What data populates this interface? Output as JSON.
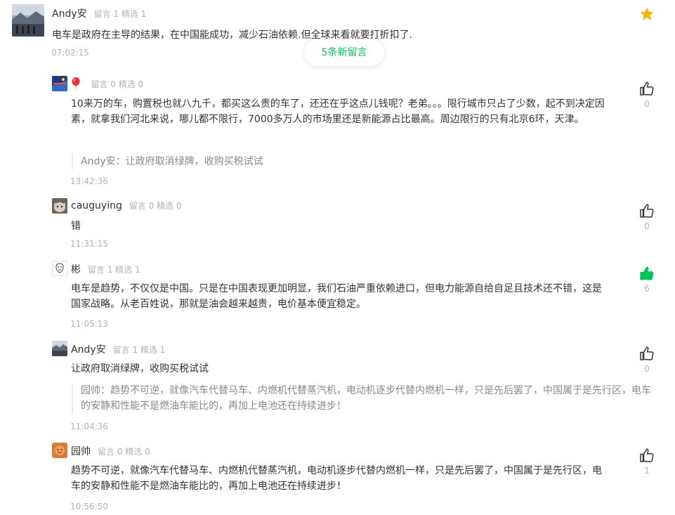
{
  "colors": {
    "accent_green": "#07c160",
    "star_gold": "#f4b400",
    "meta_gray": "#b2b2b2",
    "quote_gray": "#888888"
  },
  "top_comment": {
    "name": "Andy安",
    "meta": "留言 1 精选 1",
    "text": "电车是政府在主导的结果，在中国能成功，减少石油依赖.但全球来看就要打折扣了.",
    "time": "07:02:15",
    "star_icon": "star-icon"
  },
  "new_messages_pill": "5条新留言",
  "replies": [
    {
      "name": "",
      "name_icon": "balloon-icon",
      "meta": "留言 0 精选 0",
      "text": "10来万的车，购置税也就八九千，都买这么贵的车了，还还在乎这点儿钱呢？老弟。。。限行城市只占了少数，起不到决定因素，就拿我们河北来说，哪儿都不限行，7000多万人的市场里还是新能源占比最高。周边限行的只有北京6环，天津。",
      "quote": "Andy安：让政府取消绿牌，收购买税试试",
      "time": "13:42:36",
      "likes": "0",
      "liked": false
    },
    {
      "name": "cauguying",
      "meta": "留言 0 精选 0",
      "text": "错",
      "time": "11:31:15",
      "likes": "0",
      "liked": false
    },
    {
      "name": "彬",
      "meta": "留言 1 精选 1",
      "text": "电车是趋势，不仅仅是中国。只是在中国表现更加明显，我们石油严重依赖进口，但电力能源自给自足且技术还不错，这是国家战略。从老百姓说，那就是油会越来越贵，电价基本便宜稳定。",
      "time": "11:05:13",
      "likes": "6",
      "liked": true
    },
    {
      "name": "Andy安",
      "meta": "留言 1 精选 1",
      "text": "让政府取消绿牌，收购买税试试",
      "quote": "园帅：趋势不可逆，就像汽车代替马车、内燃机代替蒸汽机，电动机逐步代替内燃机一样，只是先后罢了，中国属于是先行区，电车的安静和性能不是燃油车能比的，再加上电池还在持续进步！",
      "time": "11:04:36",
      "likes": "0",
      "liked": false
    },
    {
      "name": "园帅",
      "meta": "留言 0 精选 0",
      "text": "趋势不可逆，就像汽车代替马车、内燃机代替蒸汽机，电动机逐步代替内燃机一样，只是先后罢了，中国属于是先行区，电车的安静和性能不是燃油车能比的，再加上电池还在持续进步！",
      "time": "10:56:50",
      "likes": "1",
      "liked": false
    }
  ]
}
